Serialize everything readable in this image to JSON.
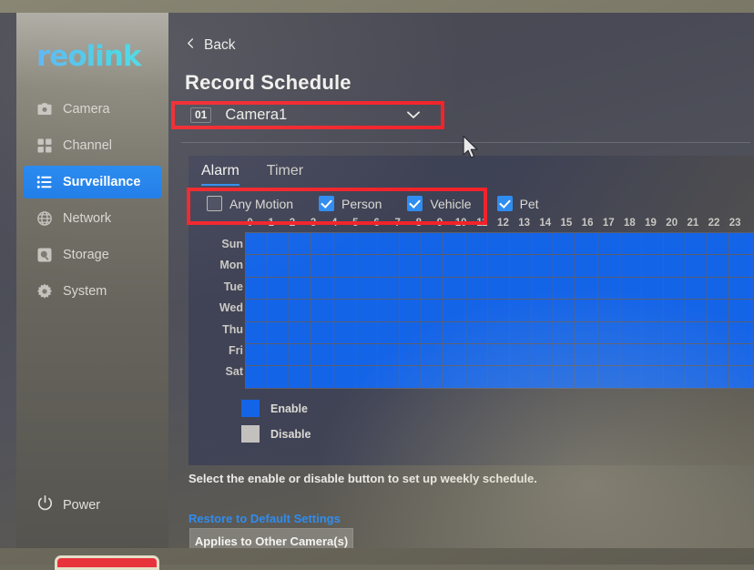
{
  "brand": {
    "logo_text": "reolink"
  },
  "sidebar": {
    "items": [
      {
        "label": "Camera",
        "icon": "camera-icon",
        "active": false
      },
      {
        "label": "Channel",
        "icon": "grid-icon",
        "active": false
      },
      {
        "label": "Surveillance",
        "icon": "list-icon",
        "active": true
      },
      {
        "label": "Network",
        "icon": "globe-icon",
        "active": false
      },
      {
        "label": "Storage",
        "icon": "storage-disk-icon",
        "active": false
      },
      {
        "label": "System",
        "icon": "gear-icon",
        "active": false
      }
    ],
    "power_label": "Power",
    "power_icon": "power-icon"
  },
  "header": {
    "back_label": "Back",
    "back_icon": "chevron-left-icon",
    "title": "Record Schedule"
  },
  "camera_select": {
    "number": "01",
    "name": "Camera1",
    "caret_icon": "chevron-down-icon"
  },
  "tabs": [
    {
      "label": "Alarm",
      "active": true
    },
    {
      "label": "Timer",
      "active": false
    }
  ],
  "detection_filters": [
    {
      "label": "Any Motion",
      "checked": false
    },
    {
      "label": "Person",
      "checked": true
    },
    {
      "label": "Vehicle",
      "checked": true
    },
    {
      "label": "Pet",
      "checked": true
    }
  ],
  "schedule": {
    "hours": [
      "0",
      "1",
      "2",
      "3",
      "4",
      "5",
      "6",
      "7",
      "8",
      "9",
      "10",
      "11",
      "12",
      "13",
      "14",
      "15",
      "16",
      "17",
      "18",
      "19",
      "20",
      "21",
      "22",
      "23"
    ],
    "days": [
      "Sun",
      "Mon",
      "Tue",
      "Wed",
      "Thu",
      "Fri",
      "Sat"
    ],
    "enabled_matrix": [
      [
        1,
        1,
        1,
        1,
        1,
        1,
        1,
        1,
        1,
        1,
        1,
        1,
        1,
        1,
        1,
        1,
        1,
        1,
        1,
        1,
        1,
        1,
        1,
        1
      ],
      [
        1,
        1,
        1,
        1,
        1,
        1,
        1,
        1,
        1,
        1,
        1,
        1,
        1,
        1,
        1,
        1,
        1,
        1,
        1,
        1,
        1,
        1,
        1,
        1
      ],
      [
        1,
        1,
        1,
        1,
        1,
        1,
        1,
        1,
        1,
        1,
        1,
        1,
        1,
        1,
        1,
        1,
        1,
        1,
        1,
        1,
        1,
        1,
        1,
        1
      ],
      [
        1,
        1,
        1,
        1,
        1,
        1,
        1,
        1,
        1,
        1,
        1,
        1,
        1,
        1,
        1,
        1,
        1,
        1,
        1,
        1,
        1,
        1,
        1,
        1
      ],
      [
        1,
        1,
        1,
        1,
        1,
        1,
        1,
        1,
        1,
        1,
        1,
        1,
        1,
        1,
        1,
        1,
        1,
        1,
        1,
        1,
        1,
        1,
        1,
        1
      ],
      [
        1,
        1,
        1,
        1,
        1,
        1,
        1,
        1,
        1,
        1,
        1,
        1,
        1,
        1,
        1,
        1,
        1,
        1,
        1,
        1,
        1,
        1,
        1,
        1
      ],
      [
        1,
        1,
        1,
        1,
        1,
        1,
        1,
        1,
        1,
        1,
        1,
        1,
        1,
        1,
        1,
        1,
        1,
        1,
        1,
        1,
        1,
        1,
        1,
        1
      ]
    ]
  },
  "legend": [
    {
      "label": "Enable",
      "color": "#1464e8"
    },
    {
      "label": "Disable",
      "color": "#c3c1be"
    }
  ],
  "footer": {
    "hint": "Select the enable or disable button to set up weekly schedule.",
    "restore_label": "Restore to Default Settings",
    "apply_label": "Applies to Other Camera(s)"
  },
  "colors": {
    "accent_blue": "#2f8cf0",
    "enable_blue": "#1464e8",
    "annotation_red": "#f2232a",
    "logo_cyan": "#3fd2e8"
  },
  "annotations": [
    {
      "name": "camera-select-highlight",
      "color": "#f2232a"
    },
    {
      "name": "detection-filters-highlight",
      "color": "#f2232a"
    }
  ]
}
